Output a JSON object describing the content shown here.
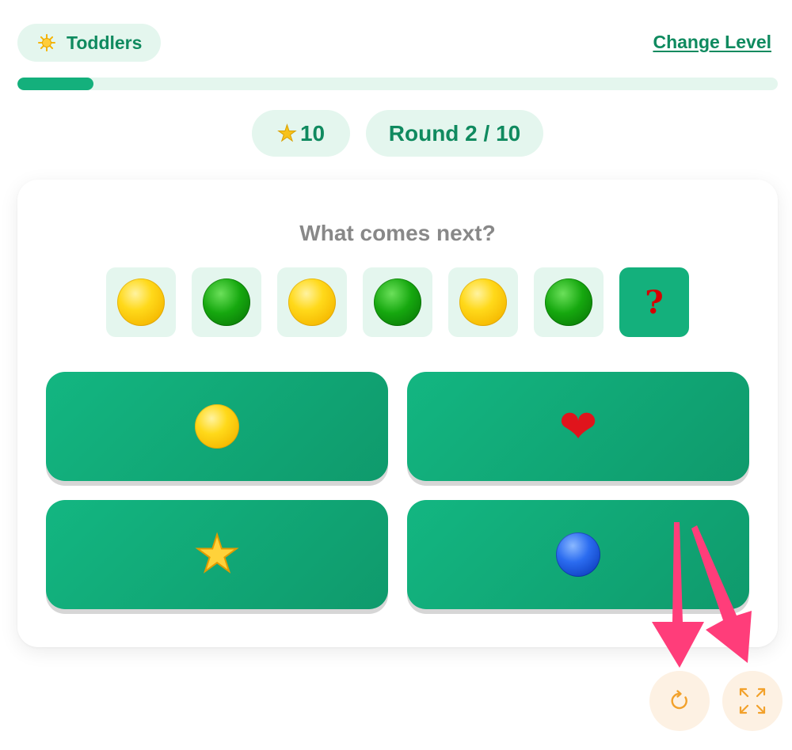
{
  "header": {
    "level_label": "Toddlers",
    "level_icon": "sun-icon",
    "change_level_label": "Change Level"
  },
  "progress": {
    "current": 1,
    "total": 10,
    "fraction": 0.1,
    "fill_color": "#14b07c"
  },
  "stats": {
    "score_icon": "star-icon",
    "score": "10",
    "round_label": "Round 2 / 10"
  },
  "question": {
    "prompt": "What comes next?",
    "sequence": [
      "yellow-circle",
      "green-circle",
      "yellow-circle",
      "green-circle",
      "yellow-circle",
      "green-circle"
    ],
    "unknown_symbol": "?"
  },
  "answers": [
    "yellow-circle",
    "red-heart",
    "star",
    "blue-circle"
  ],
  "controls": {
    "restart_icon": "restart-icon",
    "fullscreen_icon": "fullscreen-icon"
  },
  "colors": {
    "accent": "#14b07c",
    "accent_dark": "#0f8a5f",
    "pill_bg": "#e4f6ee",
    "annotation_arrow": "#ff3d7a",
    "control_icon": "#f2a12b"
  }
}
